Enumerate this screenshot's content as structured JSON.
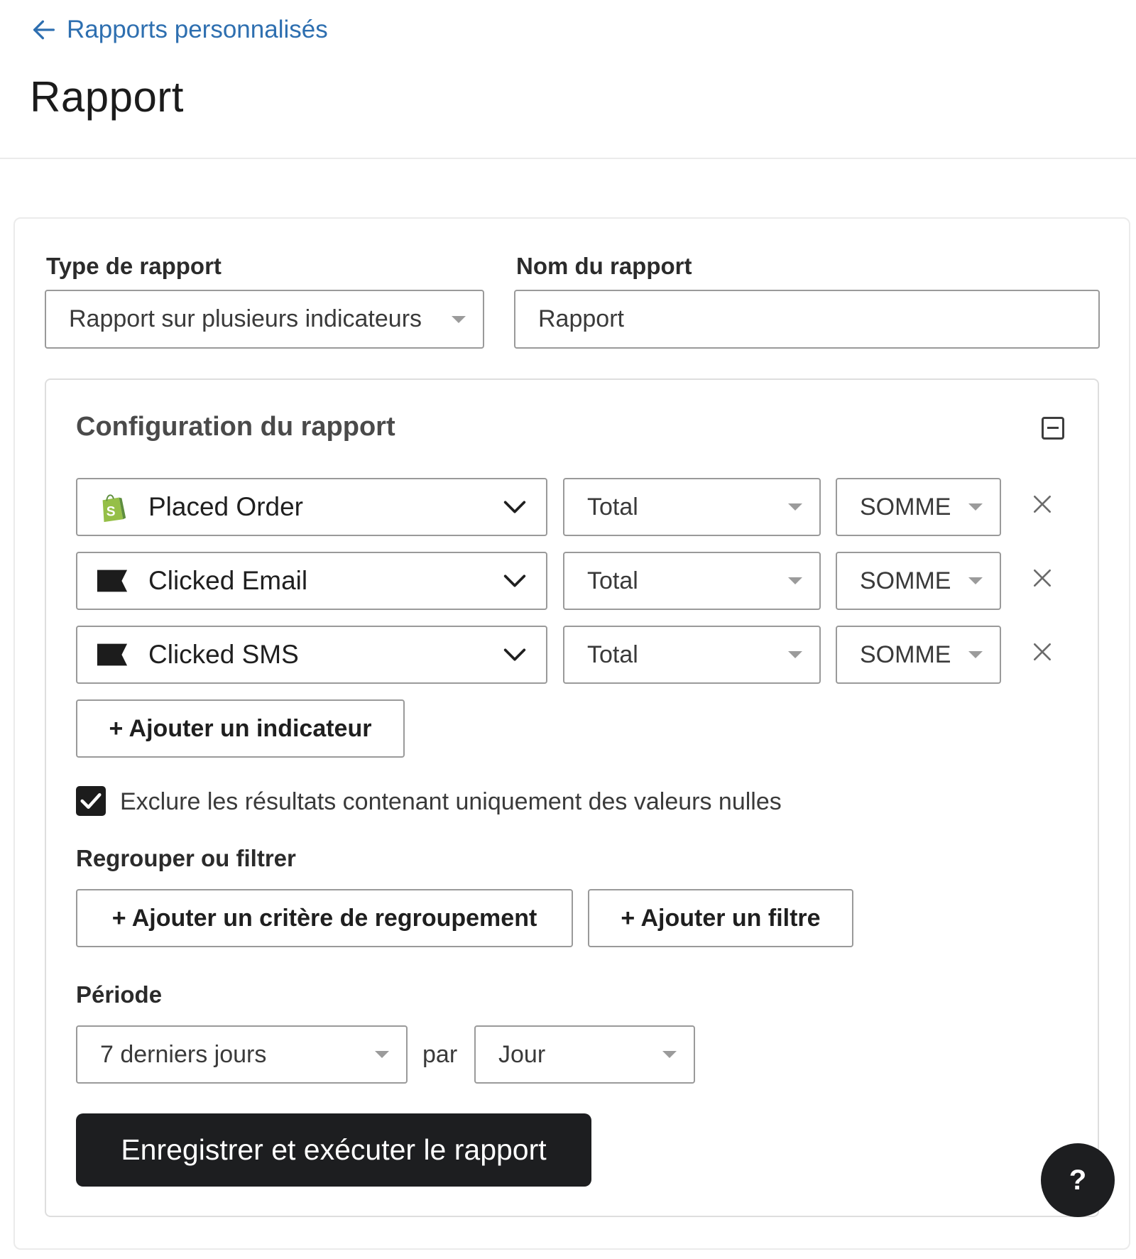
{
  "header": {
    "back_link": "Rapports personnalisés",
    "title": "Rapport"
  },
  "form": {
    "report_type_label": "Type de rapport",
    "report_type_value": "Rapport sur plusieurs indicateurs",
    "report_name_label": "Nom du rapport",
    "report_name_value": "Rapport"
  },
  "config": {
    "title": "Configuration du rapport",
    "metrics": [
      {
        "name": "Placed Order",
        "icon": "shopify-icon",
        "measure": "Total",
        "aggregation": "SOMME"
      },
      {
        "name": "Clicked Email",
        "icon": "flag-icon",
        "measure": "Total",
        "aggregation": "SOMME"
      },
      {
        "name": "Clicked SMS",
        "icon": "flag-icon",
        "measure": "Total",
        "aggregation": "SOMME"
      }
    ],
    "add_metric_label": "+ Ajouter un indicateur",
    "exclude_nulls": {
      "checked": true,
      "label": "Exclure les résultats contenant uniquement des valeurs nulles"
    },
    "group_filter_label": "Regrouper ou filtrer",
    "add_group_label": "+ Ajouter un critère de regroupement",
    "add_filter_label": "+ Ajouter un filtre",
    "period_label": "Période",
    "period_value": "7 derniers jours",
    "by_label": "par",
    "granularity_value": "Jour",
    "submit_label": "Enregistrer et exécuter le rapport"
  },
  "help": {
    "label": "?"
  },
  "colors": {
    "link": "#2e6fb0",
    "primary_button": "#1d1e20",
    "shopify_green": "#95bf47"
  }
}
